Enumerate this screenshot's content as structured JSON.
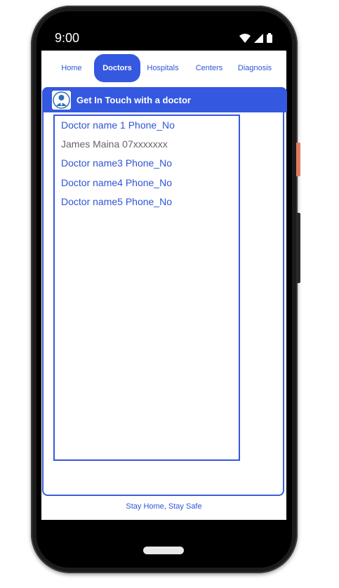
{
  "status_bar": {
    "time": "9:00"
  },
  "nav": {
    "items": [
      {
        "label": "Home",
        "active": false
      },
      {
        "label": "Doctors",
        "active": true
      },
      {
        "label": "Hospitals",
        "active": false
      },
      {
        "label": "Centers",
        "active": false
      },
      {
        "label": "Diagnosis",
        "active": false
      }
    ]
  },
  "card": {
    "title": "Get In Touch with a doctor",
    "contacts": [
      {
        "text": "Doctor name 1 Phone_No"
      },
      {
        "text": "James Maina 07xxxxxxx"
      },
      {
        "text": "Doctor name3 Phone_No"
      },
      {
        "text": "Doctor name4 Phone_No"
      },
      {
        "text": "Doctor name5 Phone_No"
      }
    ]
  },
  "footer": {
    "text": "Stay Home, Stay Safe"
  },
  "colors": {
    "accent": "#3558e0",
    "link": "#2f55d4",
    "muted": "#666666"
  }
}
